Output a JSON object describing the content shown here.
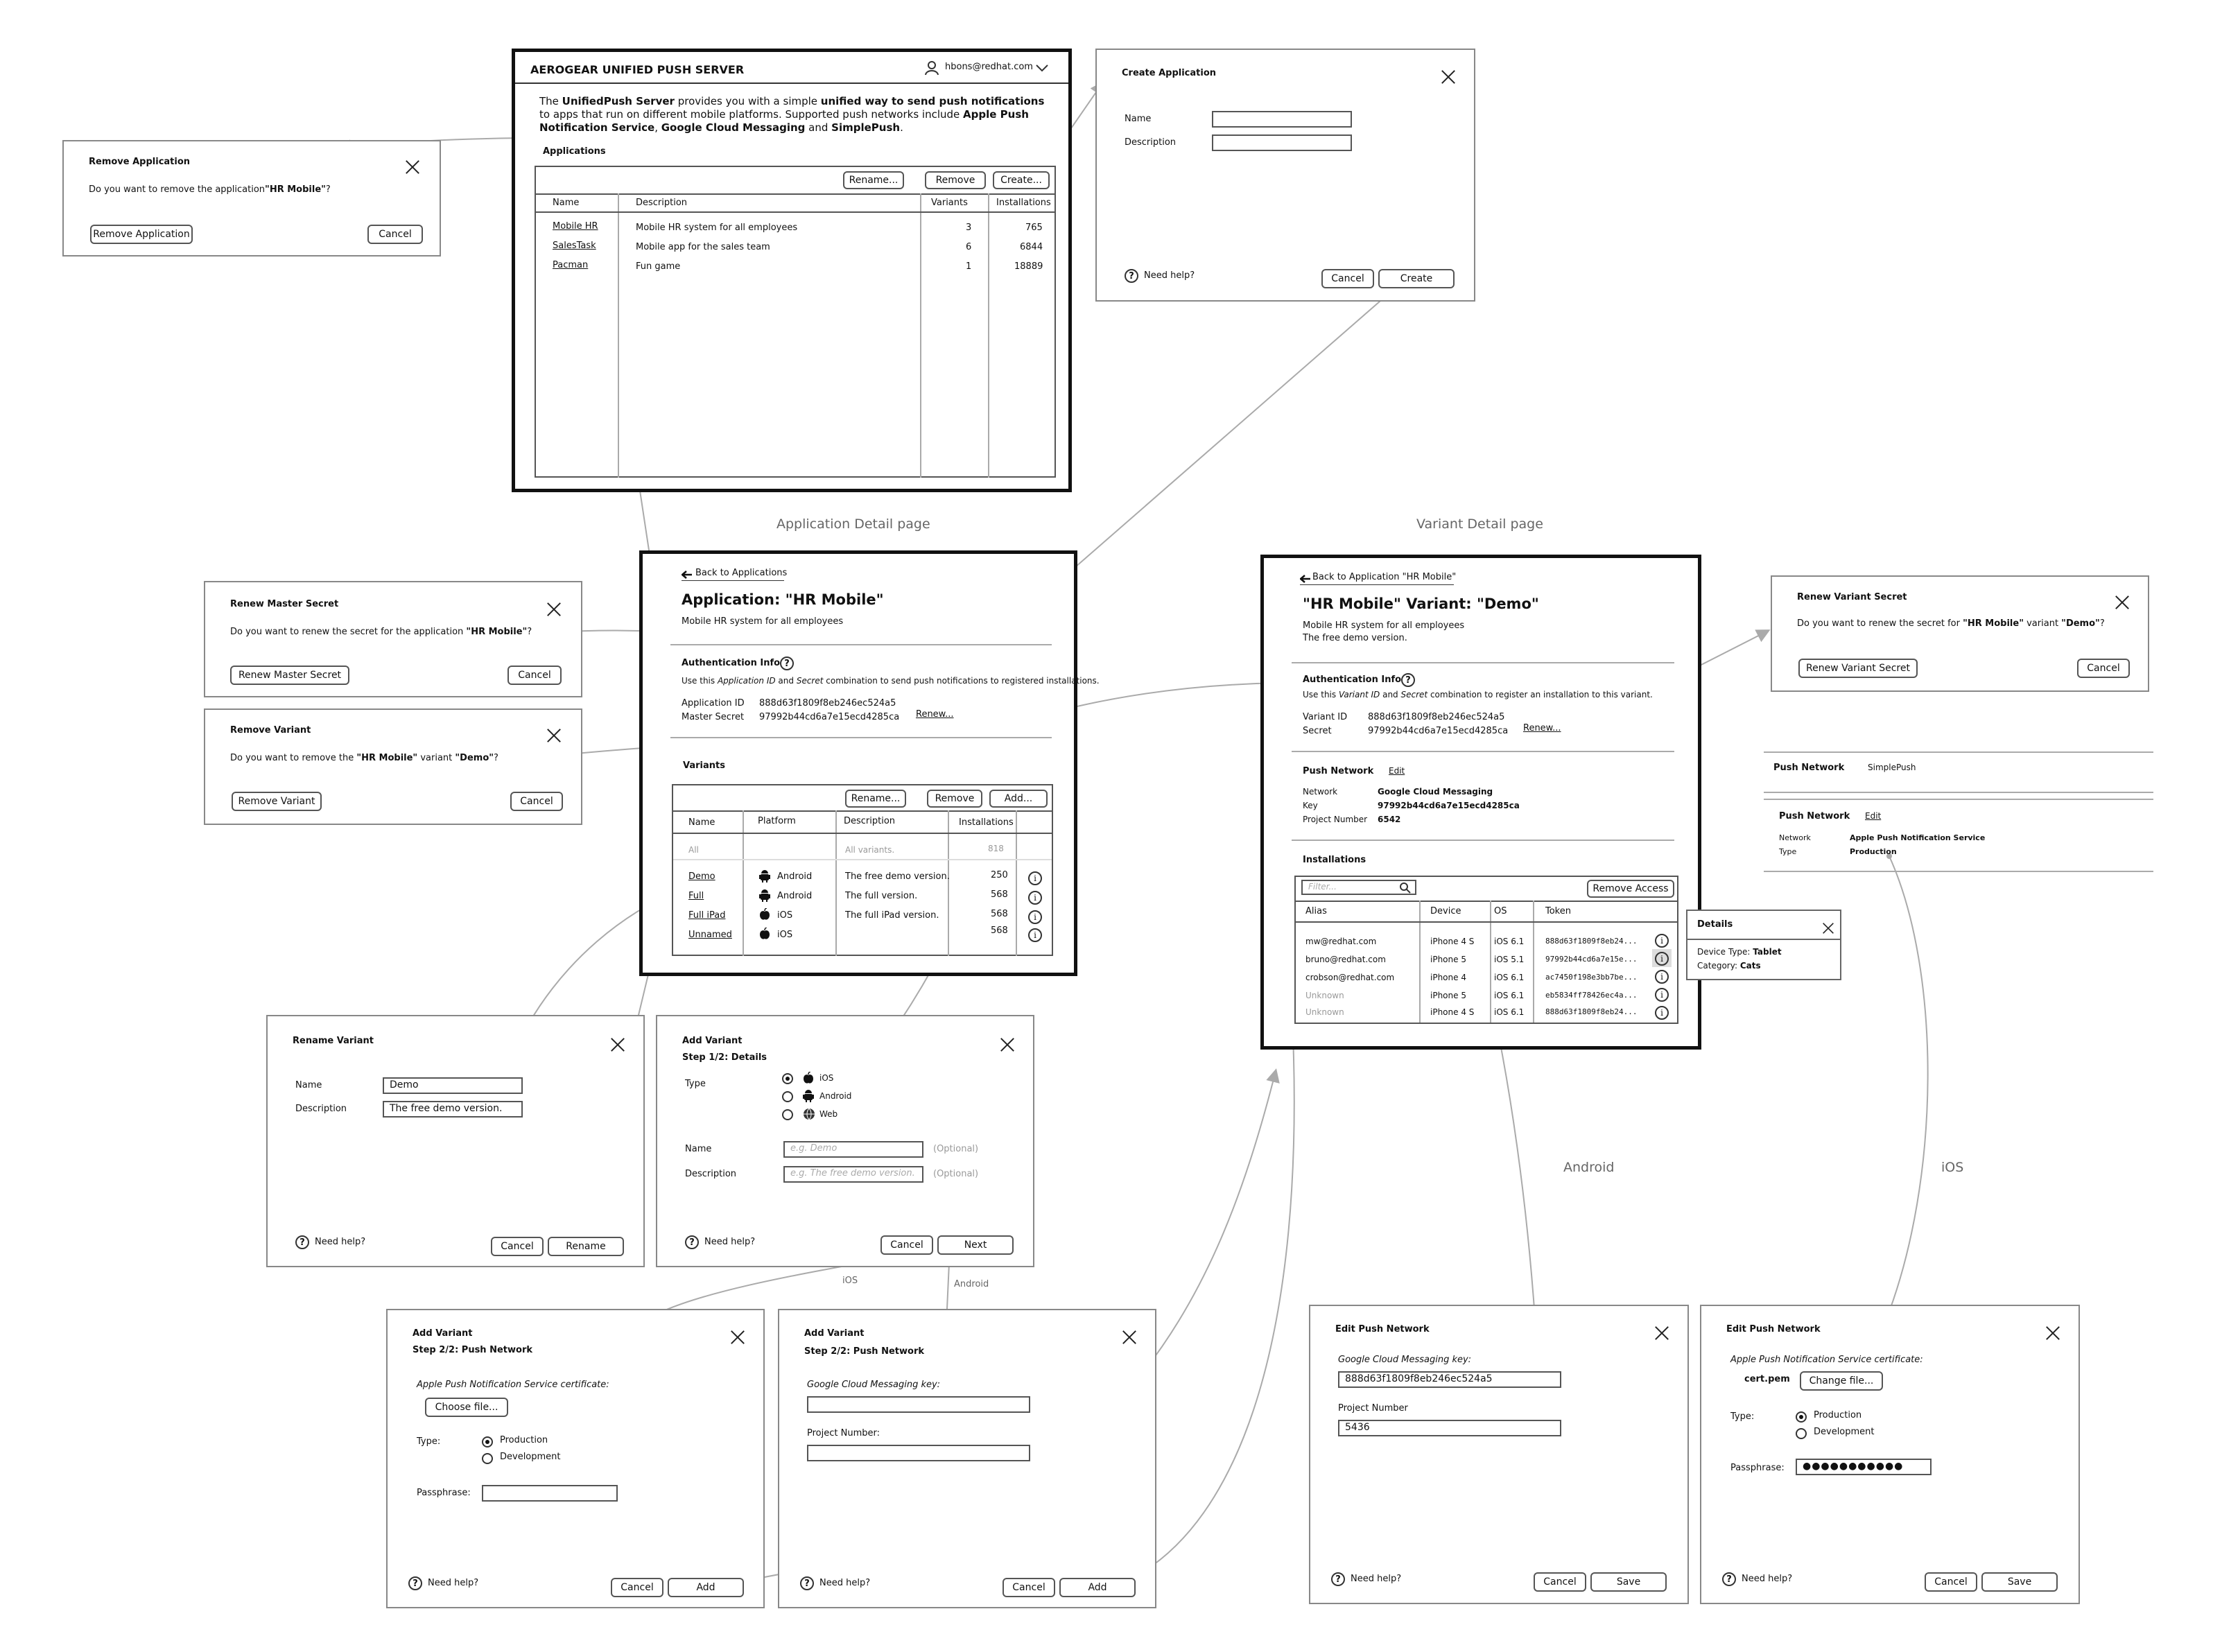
{
  "captions": {
    "app_detail_page": "Application Detail page",
    "variant_detail_page": "Variant Detail page",
    "android": "Android",
    "ios": "iOS",
    "android_small": "Android",
    "ios_small": "iOS"
  },
  "main": {
    "header_title": "AEROGEAR UNIFIED PUSH SERVER",
    "user": "hbons@redhat.com",
    "intro_parts": [
      "The ",
      "UnifiedPush Server",
      " provides you with a simple ",
      "unified way to send push notifications",
      " to apps that run on different mobile platforms. Supported push networks include ",
      "Apple Push Notification Service",
      ", ",
      "Google Cloud Messaging",
      " and ",
      "SimplePush",
      "."
    ],
    "applications_label": "Applications",
    "btn_rename": "Rename...",
    "btn_remove": "Remove",
    "btn_create": "Create...",
    "columns": [
      "Name",
      "Description",
      "Variants",
      "Installations"
    ],
    "rows": [
      {
        "name": "Mobile HR",
        "description": "Mobile HR system for all employees",
        "variants": "3",
        "installations": "765"
      },
      {
        "name": "SalesTask",
        "description": "Mobile app for the sales team",
        "variants": "6",
        "installations": "6844"
      },
      {
        "name": "Pacman",
        "description": "Fun game",
        "variants": "1",
        "installations": "18889"
      }
    ]
  },
  "remove_app": {
    "title": "Remove Application",
    "question_pre": "Do you want to remove the application",
    "question_bold": "\"HR Mobile\"",
    "question_post": "?",
    "confirm": "Remove Application",
    "cancel": "Cancel"
  },
  "create_app": {
    "title": "Create Application",
    "name_label": "Name",
    "desc_label": "Description",
    "help": "Need help?",
    "cancel": "Cancel",
    "create": "Create"
  },
  "app_detail": {
    "back": "Back to Applications",
    "title": "Application: \"HR Mobile\"",
    "subtitle": "Mobile HR system for all employees",
    "auth_title": "Authentication Info",
    "auth_desc_pre": "Use  this ",
    "auth_desc_em1": "Application ID",
    "auth_desc_mid": " and ",
    "auth_desc_em2": "Secret",
    "auth_desc_post": " combination to send push notifications to registered installations.",
    "app_id_label": "Application ID",
    "app_id": "888d63f1809f8eb246ec524a5",
    "secret_label": "Master Secret",
    "secret": "97992b44cd6a7e15ecd4285ca",
    "renew": "Renew...",
    "variants_title": "Variants",
    "btn_rename": "Rename...",
    "btn_remove": "Remove",
    "btn_add": "Add...",
    "columns": [
      "Name",
      "Platform",
      "Description",
      "Installations"
    ],
    "all_row": {
      "name": "All",
      "description": "All variants.",
      "installations": "818"
    },
    "rows": [
      {
        "name": "Demo",
        "platform": "Android",
        "description": "The free demo version.",
        "installations": "250"
      },
      {
        "name": "Full",
        "platform": "Android",
        "description": "The full version.",
        "installations": "568"
      },
      {
        "name": "Full iPad",
        "platform": "iOS",
        "description": "The full iPad version.",
        "installations": "568"
      },
      {
        "name": "Unnamed",
        "platform": "iOS",
        "description": "",
        "installations": "568"
      }
    ]
  },
  "renew_master": {
    "title": "Renew Master Secret",
    "question_pre": "Do you want to renew the secret for the application ",
    "question_bold": "\"HR Mobile\"",
    "question_post": "?",
    "confirm": "Renew Master Secret",
    "cancel": "Cancel"
  },
  "remove_variant": {
    "title": "Remove Variant",
    "question_pre": "Do you want to remove the ",
    "question_bold1": "\"HR Mobile\"",
    "question_mid": " variant ",
    "question_bold2": "\"Demo\"",
    "question_post": "?",
    "confirm": "Remove Variant",
    "cancel": "Cancel"
  },
  "rename_variant": {
    "title": "Rename Variant",
    "name_label": "Name",
    "name_value": "Demo",
    "desc_label": "Description",
    "desc_value": "The free demo version.",
    "help": "Need help?",
    "cancel": "Cancel",
    "rename": "Rename"
  },
  "add_variant1": {
    "title": "Add Variant",
    "step": "Step 1/2: Details",
    "type_label": "Type",
    "types": [
      "iOS",
      "Android",
      "Web"
    ],
    "name_label": "Name",
    "name_ph": "e.g. Demo",
    "desc_label": "Description",
    "desc_ph": "e.g. The free demo version.",
    "optional": "(Optional)",
    "help": "Need help?",
    "cancel": "Cancel",
    "next": "Next"
  },
  "add_variant_ios": {
    "title": "Add Variant",
    "step": "Step 2/2: Push Network",
    "cert_label": "Apple Push Notification Service certificate:",
    "choose": "Choose file...",
    "type_label": "Type:",
    "production": "Production",
    "development": "Development",
    "pass_label": "Passphrase:",
    "help": "Need help?",
    "cancel": "Cancel",
    "add": "Add"
  },
  "add_variant_android": {
    "title": "Add Variant",
    "step": "Step 2/2: Push Network",
    "key_label": "Google Cloud Messaging key:",
    "project_label": "Project Number:",
    "help": "Need help?",
    "cancel": "Cancel",
    "add": "Add"
  },
  "variant_detail": {
    "back": "Back to Application \"HR Mobile\"",
    "title": "\"HR Mobile\" Variant: \"Demo\"",
    "subtitle1": "Mobile HR system for all employees",
    "subtitle2": "The free demo version.",
    "auth_title": "Authentication Info",
    "auth_desc_pre": "Use  this ",
    "auth_desc_em1": "Variant ID",
    "auth_desc_mid": " and ",
    "auth_desc_em2": "Secret",
    "auth_desc_post": " combination to register an installation to this variant.",
    "variant_id_label": "Variant ID",
    "variant_id": "888d63f1809f8eb246ec524a5",
    "secret_label": "Secret",
    "secret": "97992b44cd6a7e15ecd4285ca",
    "renew": "Renew...",
    "push_title": "Push Network",
    "edit": "Edit",
    "network_label": "Network",
    "network": "Google Cloud Messaging",
    "key_label": "Key",
    "key": "97992b44cd6a7e15ecd4285ca",
    "project_label": "Project Number",
    "project": "6542",
    "install_title": "Installations",
    "filter_ph": "Filter...",
    "remove_access": "Remove Access",
    "columns": [
      "Alias",
      "Device",
      "OS",
      "Token"
    ],
    "rows": [
      {
        "alias": "mw@redhat.com",
        "device": "iPhone 4 S",
        "os": "iOS 6.1",
        "token": "888d63f1809f8eb24..."
      },
      {
        "alias": "bruno@redhat.com",
        "device": "iPhone 5",
        "os": "iOS 5.1",
        "token": "97992b44cd6a7e15e..."
      },
      {
        "alias": "crobson@redhat.com",
        "device": "iPhone 4",
        "os": "iOS 6.1",
        "token": "ac7450f198e3bb7be..."
      },
      {
        "alias": "Unknown",
        "device": "iPhone 5",
        "os": "iOS 6.1",
        "token": "eb5834ff78426ec4a..."
      },
      {
        "alias": "Unknown",
        "device": "iPhone 4 S",
        "os": "iOS 6.1",
        "token": "888d63f1809f8eb24..."
      }
    ]
  },
  "details_popup": {
    "title": "Details",
    "device_label": "Device Type: ",
    "device": "Tablet",
    "category_label": "Category: ",
    "category": "Cats"
  },
  "renew_variant": {
    "title": "Renew Variant Secret",
    "question_pre": "Do you want to renew the secret for ",
    "question_bold1": "\"HR Mobile\"",
    "question_mid": " variant ",
    "question_bold2": "\"Demo\"",
    "question_post": "?",
    "confirm": "Renew Variant Secret",
    "cancel": "Cancel"
  },
  "push_simple": {
    "title": "Push Network",
    "value": "SimplePush"
  },
  "push_apns": {
    "title": "Push Network",
    "edit": "Edit",
    "network_label": "Network",
    "network": "Apple Push Notification Service",
    "type_label": "Type",
    "type": "Production"
  },
  "edit_gcm": {
    "title": "Edit Push Network",
    "key_label": "Google Cloud Messaging key:",
    "key": "888d63f1809f8eb246ec524a5",
    "project_label": "Project Number",
    "project": "5436",
    "help": "Need help?",
    "cancel": "Cancel",
    "save": "Save"
  },
  "edit_apns": {
    "title": "Edit Push Network",
    "cert_label": "Apple Push Notification Service certificate:",
    "cert_file": "cert.pem",
    "change": "Change file...",
    "type_label": "Type:",
    "production": "Production",
    "development": "Development",
    "pass_label": "Passphrase:",
    "pass": "●●●●●●●●●●●",
    "help": "Need help?",
    "cancel": "Cancel",
    "save": "Save"
  }
}
